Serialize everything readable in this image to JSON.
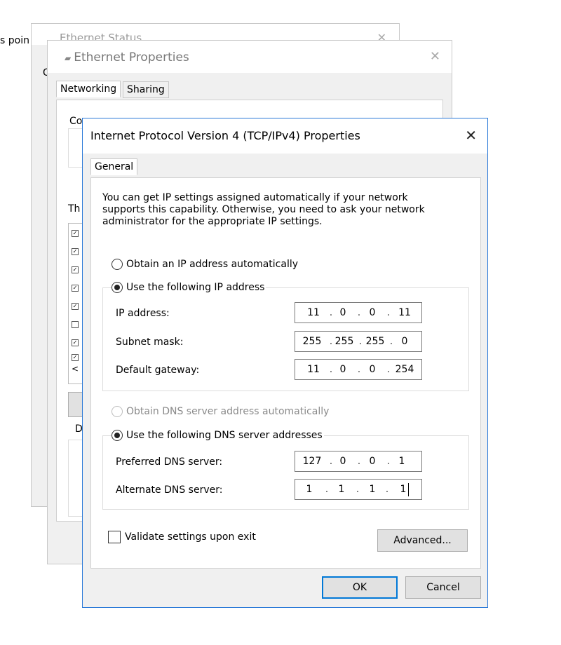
{
  "background": {
    "cut_text": "s poin"
  },
  "ethernet_status": {
    "title": "Ethernet Status",
    "close": "✕",
    "g": "G"
  },
  "ethernet_properties": {
    "title": "Ethernet Properties",
    "close": "✕",
    "tabs": [
      "Networking",
      "Sharing"
    ],
    "co": "Co",
    "th": "Th",
    "d": "D",
    "list_checks": [
      "✓",
      "✓",
      "✓",
      "✓",
      "✓",
      "",
      "✓",
      "✓"
    ],
    "scroll_arrow": "<"
  },
  "ipv4_dialog": {
    "title": "Internet Protocol Version 4 (TCP/IPv4) Properties",
    "close": "✕",
    "tab": "General",
    "intro": "You can get IP settings assigned automatically if your network supports this capability. Otherwise, you need to ask your network administrator for the appropriate IP settings.",
    "ip_auto": {
      "label": "Obtain an IP address automatically",
      "selected": false
    },
    "ip_manual": {
      "label": "Use the following IP address",
      "selected": true
    },
    "fields": [
      {
        "label": "IP address:",
        "octets": [
          "11",
          "0",
          "0",
          "11"
        ]
      },
      {
        "label": "Subnet mask:",
        "octets": [
          "255",
          "255",
          "255",
          "0"
        ]
      },
      {
        "label": "Default gateway:",
        "octets": [
          "11",
          "0",
          "0",
          "254"
        ]
      }
    ],
    "dns_auto": {
      "label": "Obtain DNS server address automatically",
      "selected": false,
      "disabled": true
    },
    "dns_manual": {
      "label": "Use the following DNS server addresses",
      "selected": true
    },
    "dns_fields": [
      {
        "label": "Preferred DNS server:",
        "octets": [
          "127",
          "0",
          "0",
          "1"
        ]
      },
      {
        "label": "Alternate DNS server:",
        "octets": [
          "1",
          "1",
          "1",
          "1"
        ]
      }
    ],
    "validate": {
      "label": "Validate settings upon exit",
      "checked": false
    },
    "advanced_label": "Advanced...",
    "ok_label": "OK",
    "cancel_label": "Cancel"
  },
  "colors": {
    "accent": "#0078d7",
    "window_border": "#2b79d8",
    "dialog_bg": "#f0f0f0"
  }
}
